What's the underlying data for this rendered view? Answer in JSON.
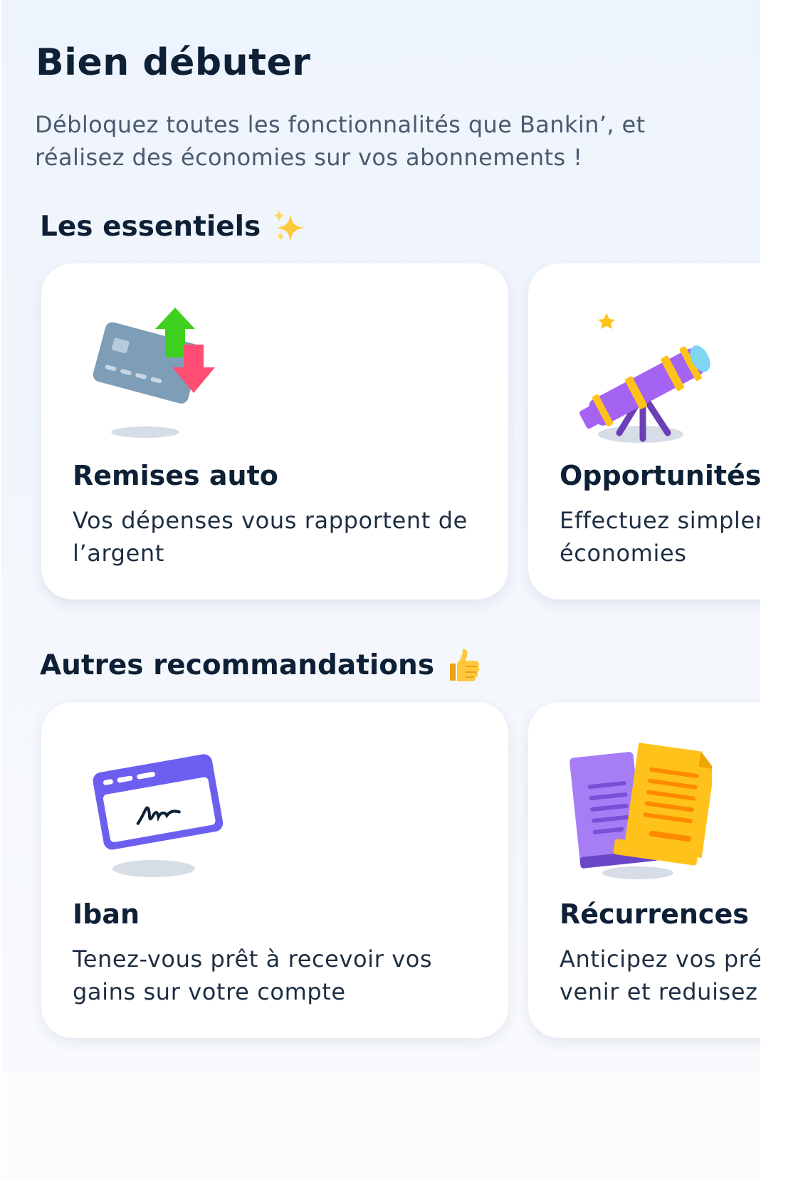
{
  "header": {
    "title": "Bien débuter",
    "subtitle_lines": [
      "Débloquez toutes les fonctionnalités que Bankin’, et",
      "réalisez des économies sur vos abonnements !"
    ]
  },
  "sections": [
    {
      "title": "Les essentiels",
      "emoji_icon": "sparkles-icon",
      "cards": [
        {
          "title": "Remises auto",
          "description_lines": [
            "Vos dépenses vous rapportent de",
            "l’argent"
          ],
          "icon": "credit-card-transfer-icon"
        },
        {
          "title": "Opportunités",
          "description_lines": [
            "Effectuez simplement des",
            "économies"
          ],
          "icon": "telescope-icon"
        }
      ]
    },
    {
      "title": "Autres recommandations",
      "emoji_icon": "thumbs-up-icon",
      "cards": [
        {
          "title": "Iban",
          "description_lines": [
            "Tenez-vous prêt à recevoir vos",
            "gains sur votre compte"
          ],
          "icon": "signed-document-icon"
        },
        {
          "title": "Récurrences",
          "description_lines": [
            "Anticipez vos prélèvements à",
            "venir et reduisez vos frais"
          ],
          "icon": "documents-stack-icon"
        }
      ]
    }
  ],
  "colors": {
    "background": "#eef4fd",
    "card": "#ffffff",
    "title_text": "#0d2036",
    "subtitle_text": "#4a5a6e"
  }
}
